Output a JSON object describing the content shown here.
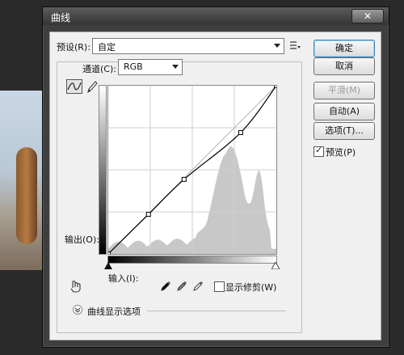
{
  "window": {
    "title": "曲线",
    "close_glyph": "✕"
  },
  "preset": {
    "label": "预设(R):",
    "value": "自定"
  },
  "channel": {
    "label": "通道(C):",
    "value": "RGB"
  },
  "buttons": {
    "ok": "确定",
    "cancel": "取消",
    "smooth": "平滑(M)",
    "auto": "自动(A)",
    "options": "选项(T)..."
  },
  "preview": {
    "label": "预览(P)",
    "checked": true
  },
  "output_label": "输出(O):",
  "input_label": "输入(I):",
  "show_clipping": {
    "label": "显示修剪(W)",
    "checked": false
  },
  "curve_display_options": "曲线显示选项",
  "curve_points": [
    [
      0,
      0
    ],
    [
      61,
      60
    ],
    [
      115,
      113
    ],
    [
      201,
      184
    ],
    [
      255,
      255
    ]
  ],
  "colors": {
    "dialog_bg": "#f0f0f0",
    "title_bar": "#3f3f3f",
    "histogram": "#c8c8c8",
    "curve": "#000000"
  },
  "icons": [
    "preset-options-icon",
    "curve-tool-icon",
    "pencil-tool-icon",
    "on-image-adjust-icon",
    "black-eyedropper-icon",
    "gray-eyedropper-icon",
    "white-eyedropper-icon",
    "expand-chevron-icon"
  ]
}
